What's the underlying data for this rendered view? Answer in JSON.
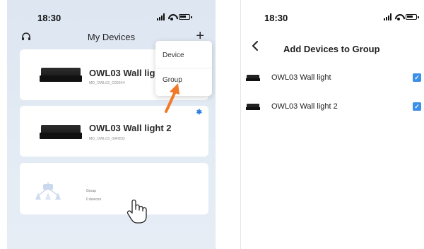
{
  "left_screen": {
    "status": {
      "time": "18:30"
    },
    "header": {
      "title": "My Devices",
      "plus_label": "+"
    },
    "devices": [
      {
        "name": "OWL03 Wall light",
        "id": "MD_OWL03_C06544",
        "bluetooth": false
      },
      {
        "name": "OWL03 Wall light 2",
        "id": "MD_OWL03_09F85D",
        "bluetooth": true
      }
    ],
    "group_card": {
      "label": "Group",
      "count": "0 devices"
    },
    "dropdown": {
      "items": [
        "Device",
        "Group"
      ]
    },
    "colors": {
      "accent_arrow": "#f07a2a",
      "bluetooth": "#2a7de1",
      "background": "#dde6f1"
    }
  },
  "right_screen": {
    "status": {
      "time": "18:30"
    },
    "header": {
      "back_icon": "chevron-left-icon",
      "title": "Add Devices to Group"
    },
    "rows": [
      {
        "name": "OWL03 Wall light",
        "checked": true
      },
      {
        "name": "OWL03 Wall light 2",
        "checked": true
      }
    ],
    "colors": {
      "checkbox": "#3b8fe8"
    }
  }
}
